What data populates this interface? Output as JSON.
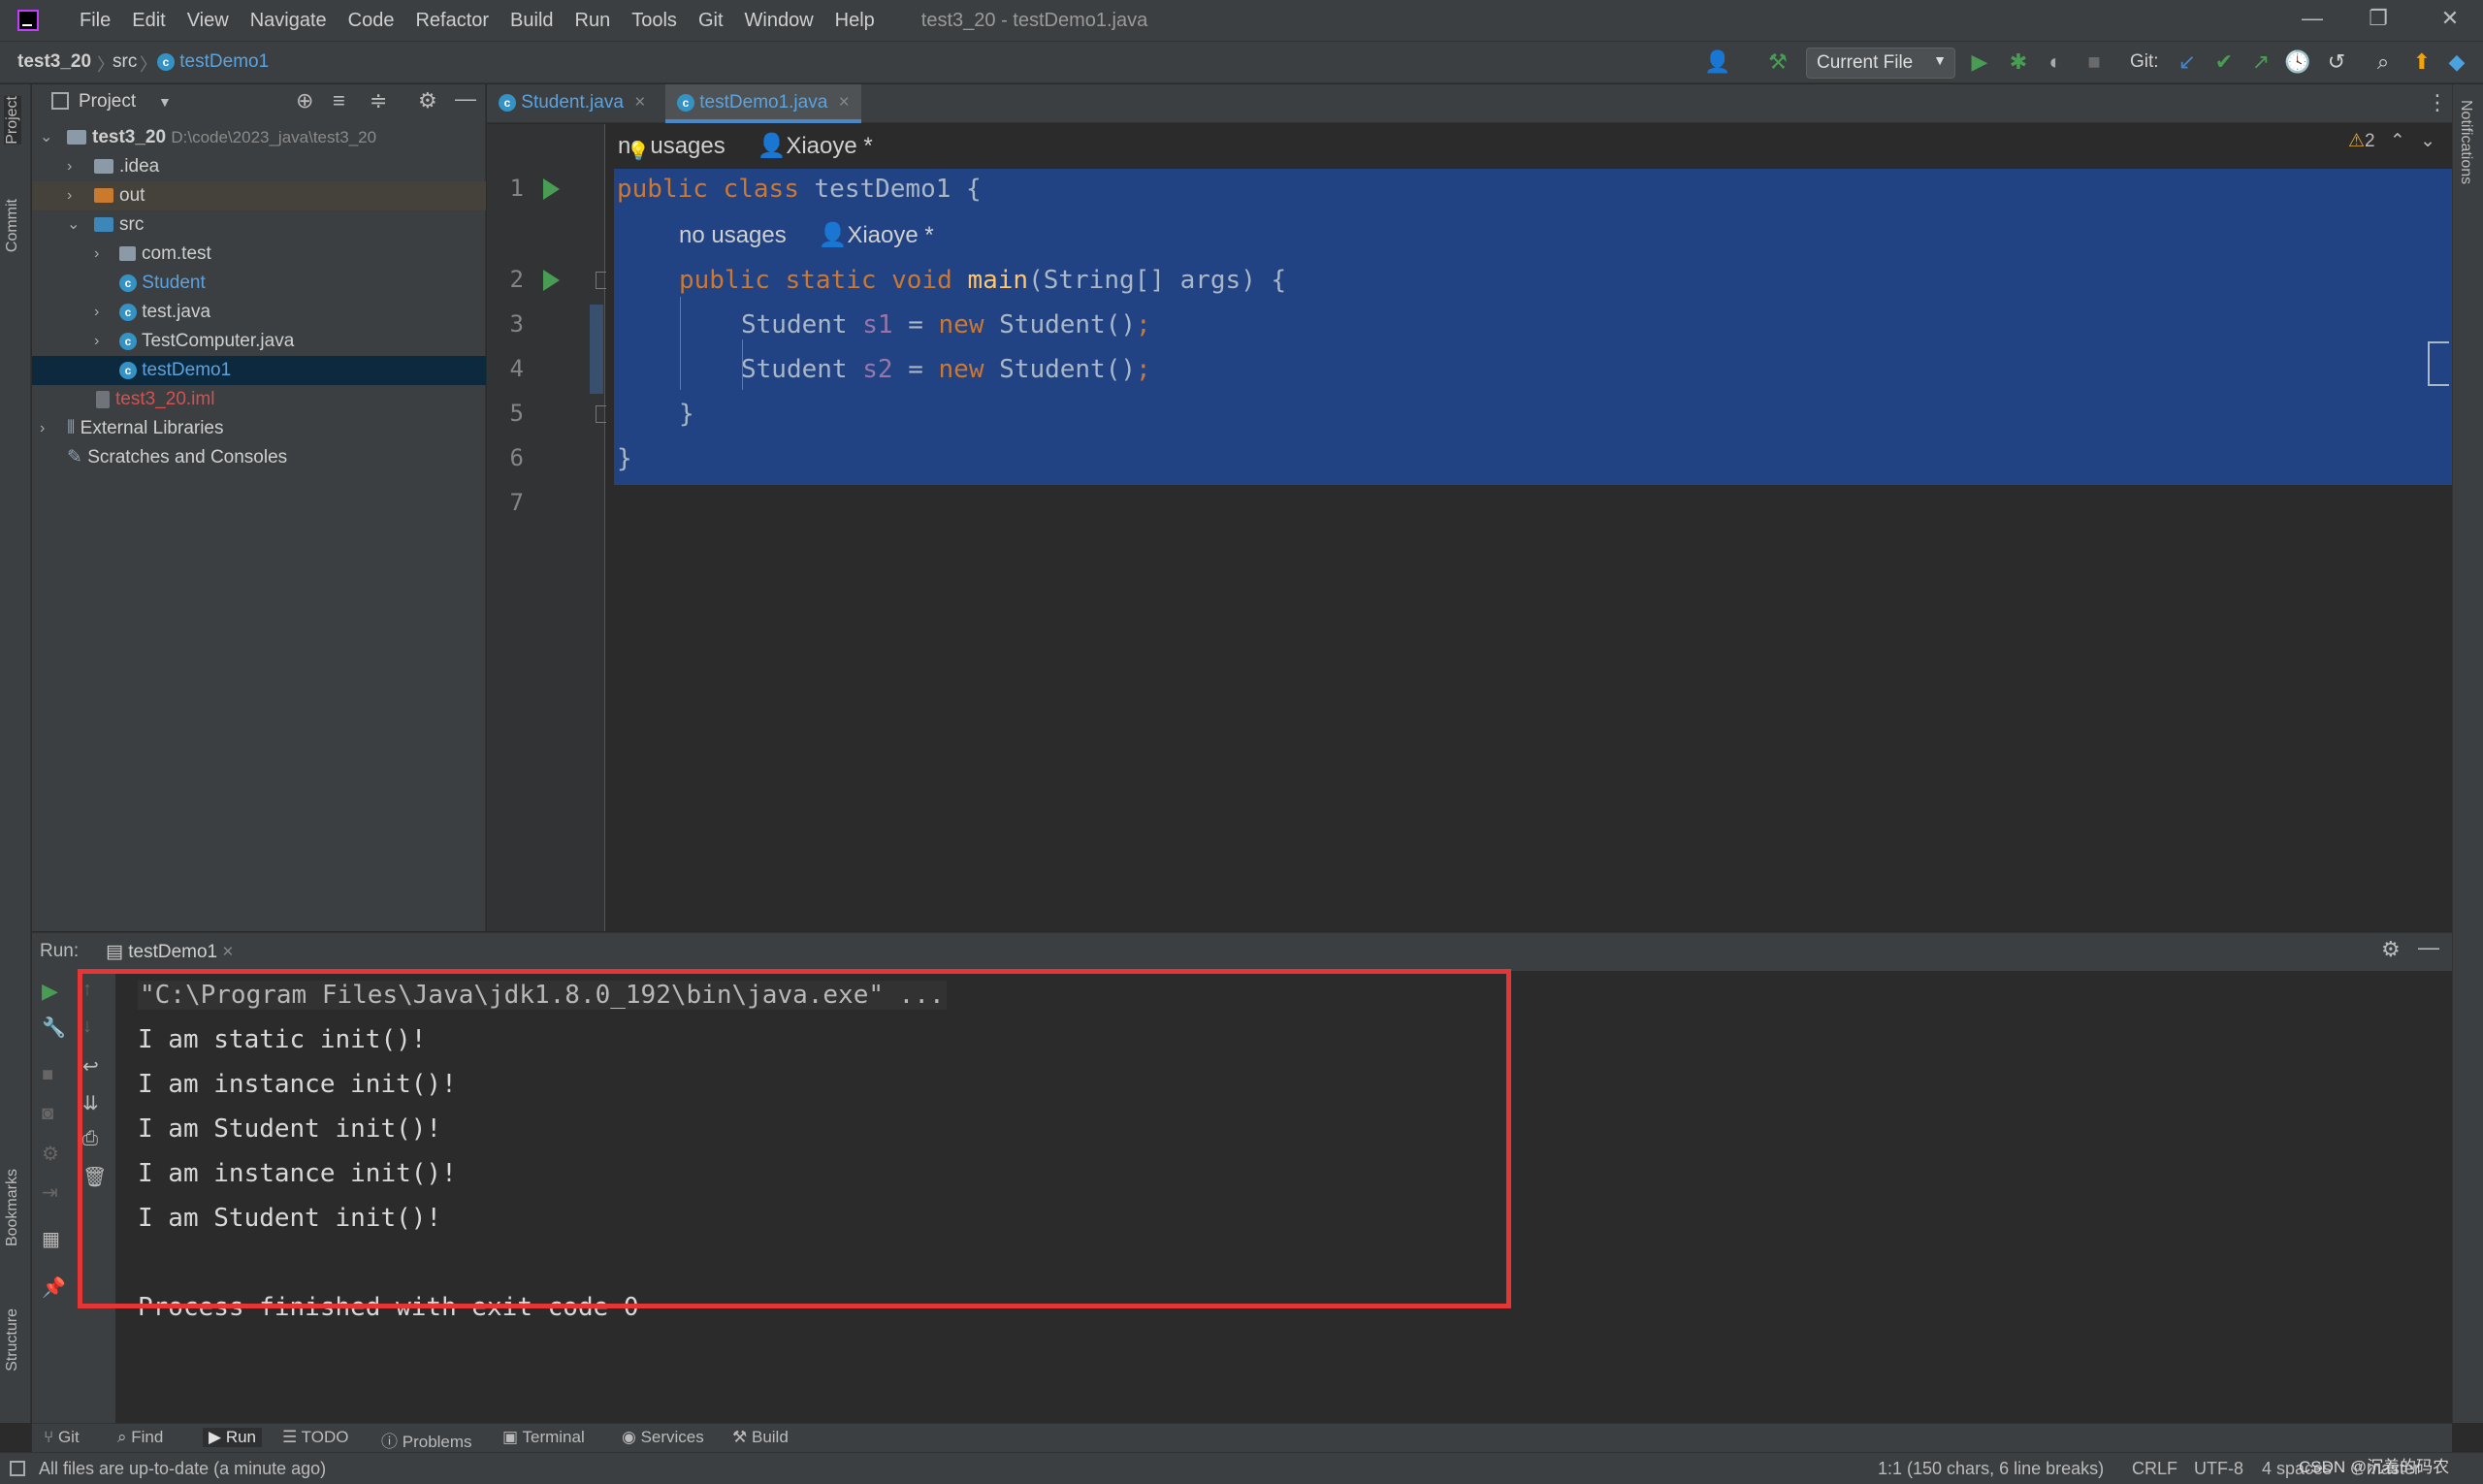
{
  "menubar": {
    "items": [
      "File",
      "Edit",
      "View",
      "Navigate",
      "Code",
      "Refactor",
      "Build",
      "Run",
      "Tools",
      "Git",
      "Window",
      "Help"
    ],
    "title": "test3_20 - testDemo1.java",
    "minimize": "—",
    "restore": "❐",
    "close": "✕"
  },
  "navbar": {
    "crumb_project": "test3_20",
    "crumb_src": "src",
    "crumb_file": "testDemo1",
    "run_config": "Current File",
    "git_label": "Git:"
  },
  "project_panel": {
    "title": "Project",
    "tree": [
      {
        "label": "test3_20",
        "path": "D:\\code\\2023_java\\test3_20"
      },
      {
        "label": ".idea"
      },
      {
        "label": "out"
      },
      {
        "label": "src"
      },
      {
        "label": "com.test"
      },
      {
        "label": "Student"
      },
      {
        "label": "test.java"
      },
      {
        "label": "TestComputer.java"
      },
      {
        "label": "testDemo1"
      },
      {
        "label": "test3_20.iml"
      },
      {
        "label": "External Libraries"
      },
      {
        "label": "Scratches and Consoles"
      }
    ]
  },
  "side_tabs": {
    "project": "Project",
    "commit": "Commit",
    "bookmarks": "Bookmarks",
    "structure": "Structure",
    "notifications": "Notifications"
  },
  "editor": {
    "tabs": [
      {
        "label": "Student.java"
      },
      {
        "label": "testDemo1.java"
      }
    ],
    "inlay_usages": "no usages",
    "inlay_author": "Xiaoye *",
    "warning_count": "2",
    "line_numbers": [
      "1",
      "2",
      "3",
      "4",
      "5",
      "6",
      "7"
    ],
    "code": {
      "l1_public": "public",
      "l1_class": "class",
      "l1_rest": "testDemo1 {",
      "l2_public": "public",
      "l2_static": "static",
      "l2_void": "void",
      "l2_main": "main",
      "l2_rest": "(String[] args) {",
      "l3_type": "Student",
      "l3_var": "s1",
      "l3_eq": "=",
      "l3_new": "new",
      "l3_rest": "Student()",
      "l3_semi": ";",
      "l4_type": "Student",
      "l4_var": "s2",
      "l4_eq": "=",
      "l4_new": "new",
      "l4_rest": "Student()",
      "l4_semi": ";",
      "l5": "}",
      "l6": "}"
    }
  },
  "run_panel": {
    "label": "Run:",
    "tab": "testDemo1",
    "output": [
      "\"C:\\Program Files\\Java\\jdk1.8.0_192\\bin\\java.exe\" ...",
      "I am static init()!",
      "I am instance init()!",
      "I am Student init()!",
      "I am instance init()!",
      "I am Student init()!",
      "",
      "Process finished with exit code 0"
    ]
  },
  "tool_windows": [
    "Git",
    "Find",
    "Run",
    "TODO",
    "Problems",
    "Terminal",
    "Services",
    "Build"
  ],
  "status": {
    "message": "All files are up-to-date (a minute ago)",
    "position": "1:1 (150 chars, 6 line breaks)",
    "line_sep": "CRLF",
    "encoding": "UTF-8",
    "indent": "4 spaces",
    "branch": "master",
    "watermark": "CSDN @沉着的码农"
  }
}
